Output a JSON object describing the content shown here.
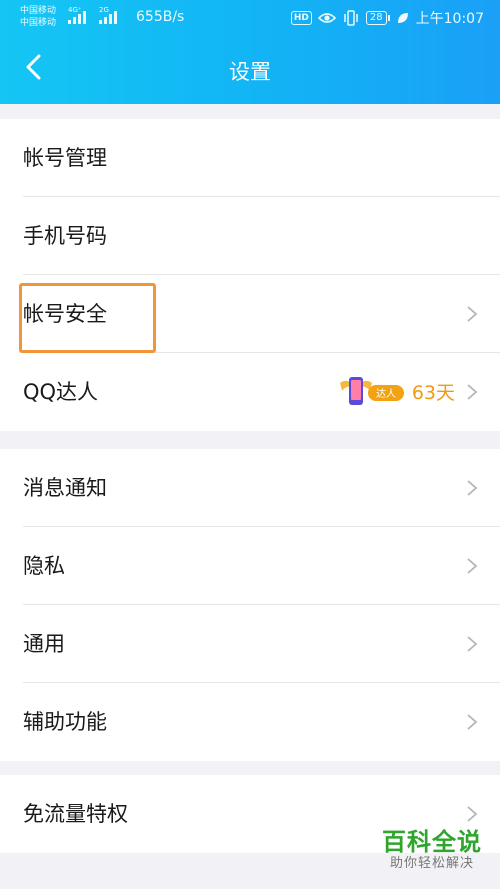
{
  "status_bar": {
    "carrier1": "中国移动",
    "carrier2": "中国移动",
    "net1": "4G⁺",
    "net2": "2G",
    "speed": "655B/s",
    "hd": "HD",
    "battery": "28",
    "time": "上午10:07"
  },
  "header": {
    "title": "设置",
    "back_icon": "chevron-left-icon"
  },
  "sections": [
    {
      "items": [
        {
          "label": "帐号管理",
          "chevron": false
        },
        {
          "label": "手机号码",
          "chevron": false
        },
        {
          "label": "帐号安全",
          "chevron": true,
          "highlighted": true
        },
        {
          "label": "QQ达人",
          "chevron": true,
          "badge_text": "达人",
          "days": "63天"
        }
      ]
    },
    {
      "items": [
        {
          "label": "消息通知",
          "chevron": true
        },
        {
          "label": "隐私",
          "chevron": true
        },
        {
          "label": "通用",
          "chevron": true
        },
        {
          "label": "辅助功能",
          "chevron": true
        }
      ]
    },
    {
      "items": [
        {
          "label": "免流量特权",
          "chevron": true
        }
      ]
    }
  ],
  "watermark": {
    "main": "百科全说",
    "sub": "助你轻松解决"
  },
  "colors": {
    "header_start": "#14c6f4",
    "header_end": "#1aa0f7",
    "highlight": "#f0953a",
    "talent_orange": "#f19a14",
    "watermark_green": "#2fa52e"
  }
}
